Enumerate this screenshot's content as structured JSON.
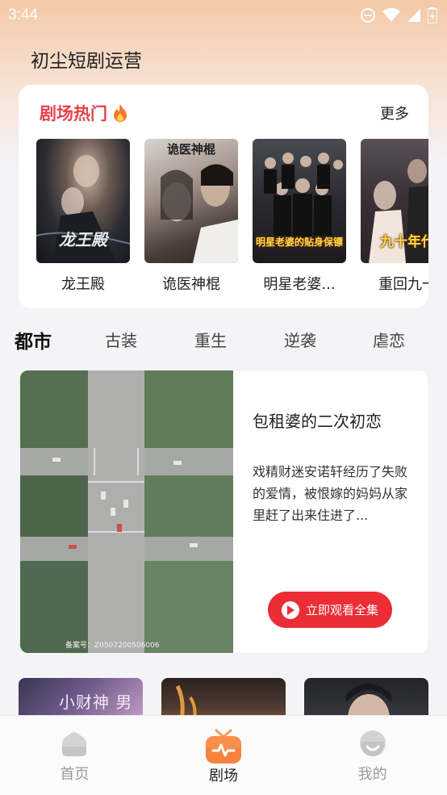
{
  "status_bar": {
    "time": "3:44"
  },
  "app": {
    "title": "初尘短剧运营"
  },
  "hot_section": {
    "title": "剧场热门",
    "more_label": "更多",
    "dramas": [
      {
        "name": "龙王殿",
        "poster_caption": "龙王殿"
      },
      {
        "name": "诡医神棍",
        "poster_caption": "诡医神棍"
      },
      {
        "name": "明星老婆...",
        "poster_caption": "明星老婆的贴身保镖"
      },
      {
        "name": "重回九一",
        "poster_caption": "九十年代"
      }
    ]
  },
  "category_tabs": [
    "都市",
    "古装",
    "重生",
    "逆袭",
    "虐恋"
  ],
  "active_category": "都市",
  "feature": {
    "title": "包租婆的二次初恋",
    "description": "戏精财迷安诺轩经历了失败的爱情，被恨嫁的妈妈从家里赶了出来住进了...",
    "watch_label": "立即观看全集",
    "image_caption": "备案号：Z0507200506006"
  },
  "bottom_thumbs": [
    {
      "caption": "小财神 男友"
    },
    {
      "caption": ""
    },
    {
      "caption": ""
    }
  ],
  "bottom_nav": [
    {
      "label": "首页",
      "icon": "home-icon"
    },
    {
      "label": "剧场",
      "icon": "theater-icon"
    },
    {
      "label": "我的",
      "icon": "profile-icon"
    }
  ],
  "colors": {
    "accent": "#e8414a",
    "button": "#ec2d36",
    "nav_active": "#f6833d"
  }
}
